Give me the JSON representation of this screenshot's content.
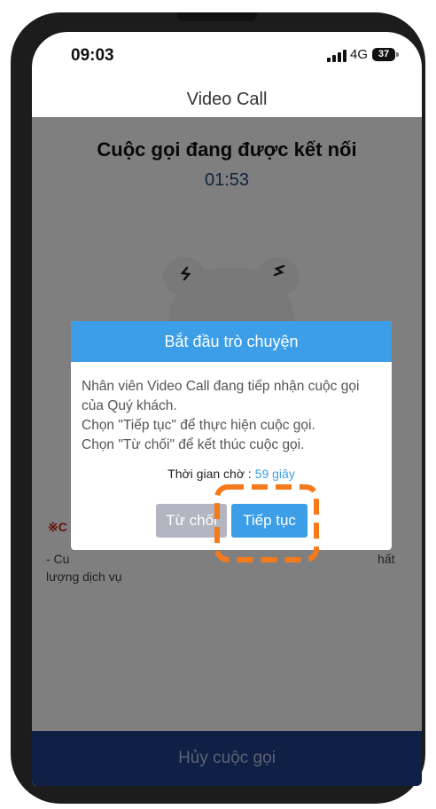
{
  "status_bar": {
    "time": "09:03",
    "network": "4G",
    "battery": "37"
  },
  "app_bar": {
    "title": "Video Call"
  },
  "call": {
    "status": "Cuộc gọi đang được kết nối",
    "timer": "01:53"
  },
  "note": {
    "title": "※C",
    "line_start": "- Cu",
    "line_end": "hất",
    "line2": "lượng dịch vụ"
  },
  "bottom": {
    "cancel_label": "Hủy cuộc gọi"
  },
  "dialog": {
    "title": "Bắt đầu trò chuyện",
    "body": "Nhân viên Video Call đang tiếp nhận cuộc gọi của Quý khách.\nChọn \"Tiếp tục\" để thực hiện cuộc gọi.\nChọn \"Từ chối\" để kết thúc cuộc gọi.",
    "wait_label": "Thời gian chờ : ",
    "wait_count": "59 giây",
    "reject_label": "Từ chối",
    "continue_label": "Tiếp tục"
  },
  "colors": {
    "accent": "#3b9ee6",
    "bottom_bar": "#1e3f8b",
    "highlight": "#f47a1c",
    "timer": "#25477f"
  }
}
